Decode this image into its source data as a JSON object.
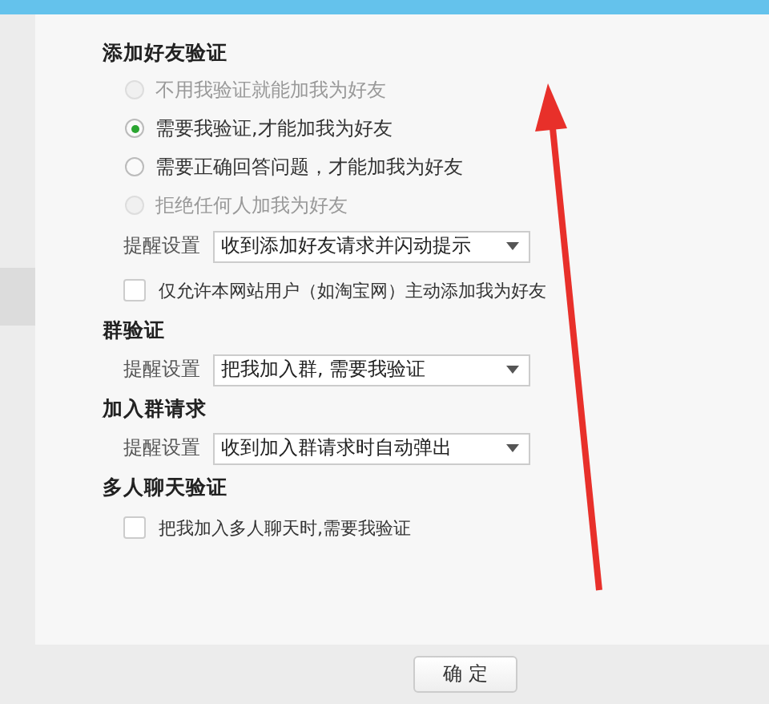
{
  "sections": [
    {
      "title": "添加好友验证",
      "items": [
        {
          "kind": "radio",
          "label": "不用我验证就能加我为好友",
          "selected": false,
          "disabled": true
        },
        {
          "kind": "radio",
          "label": "需要我验证,才能加我为好友",
          "selected": true,
          "disabled": false
        },
        {
          "kind": "radio",
          "label": "需要正确回答问题，才能加我为好友",
          "selected": false,
          "disabled": false
        },
        {
          "kind": "radio",
          "label": "拒绝任何人加我为好友",
          "selected": false,
          "disabled": true
        },
        {
          "kind": "select",
          "label": "提醒设置",
          "value": "收到添加好友请求并闪动提示"
        },
        {
          "kind": "checkbox",
          "label": "仅允许本网站用户（如淘宝网）主动添加我为好友",
          "checked": false
        }
      ]
    },
    {
      "title": "群验证",
      "items": [
        {
          "kind": "select",
          "label": "提醒设置",
          "value": "把我加入群, 需要我验证"
        }
      ]
    },
    {
      "title": "加入群请求",
      "items": [
        {
          "kind": "select",
          "label": "提醒设置",
          "value": "收到加入群请求时自动弹出"
        }
      ]
    },
    {
      "title": "多人聊天验证",
      "items": [
        {
          "kind": "checkbox",
          "label": "把我加入多人聊天时,需要我验证",
          "checked": false
        }
      ]
    }
  ],
  "buttons": [
    "确 定"
  ]
}
